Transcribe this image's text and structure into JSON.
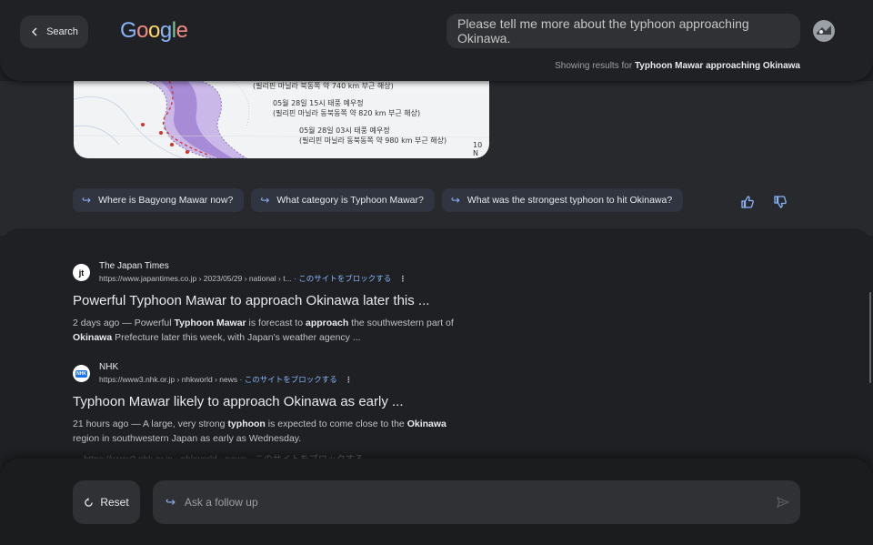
{
  "header": {
    "back_label": "Search",
    "logo": "Google",
    "query": "Please tell me more about the typhoon approaching Okinawa.",
    "showing_prefix": "Showing results for",
    "showing_query": "Typhoon Mawar approaching Okinawa"
  },
  "map": {
    "lines": [
      "(필리핀 마닐라 북동쪽 약 740 km 부근 해상)",
      "05월 28일 15시 태풍 예우정",
      "(필리핀 마닐라 동북동쪽 약 820 km 부근 해상)",
      "05월 28일 03시 태풍 예우정",
      "(필리핀 마닐라 동북동쪽 약 980 km 부근 해상)",
      "10 N"
    ]
  },
  "chips": [
    "Where is Bagyong Mawar now?",
    "What category is Typhoon Mawar?",
    "What was the strongest typhoon to hit Okinawa?"
  ],
  "results": [
    {
      "site": "The Japan Times",
      "favicon": "jt",
      "url": "https://www.japantimes.co.jp › 2023/05/29 › national › t... ·",
      "block": "このサイトをブロックする",
      "title": "Powerful Typhoon Mawar to approach Okinawa later this ...",
      "snippet": {
        "s1": "2 days ago — Powerful ",
        "b1": "Typhoon Mawar",
        "s2": " is forecast to ",
        "b2": "approach",
        "s3": " the southwestern part of ",
        "b3": "Okinawa",
        "s4": " Prefecture later this week, with Japan's weather agency ..."
      }
    },
    {
      "site": "NHK",
      "favicon": "NHK",
      "url": "https://www3.nhk.or.jp › nhkworld › news ·",
      "block": "このサイトをブロックする",
      "title": "Typhoon Mawar likely to approach Okinawa as early ...",
      "snippet": {
        "s1": "21 hours ago — A large, very strong ",
        "b1": "typhoon",
        "s2": " is expected to come close to the ",
        "b2": "Okinawa",
        "s3": " region in southwestern Japan as early as Wednesday.",
        "b3": "",
        "s4": ""
      }
    }
  ],
  "faded_row": "https://www3.nhk.or.jp › nhkworld › news · このサイトをブロックする",
  "footer": {
    "reset_label": "Reset",
    "ask_placeholder": "Ask a follow up"
  }
}
